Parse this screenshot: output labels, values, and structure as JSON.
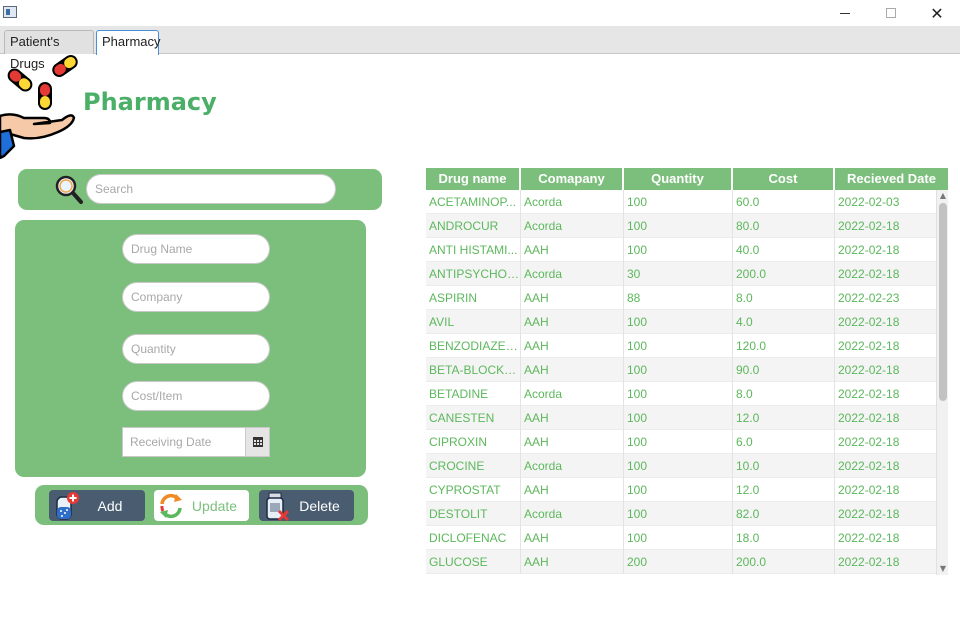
{
  "window": {
    "close_glyph": "✕"
  },
  "tabs": [
    {
      "label": "Patient's Drugs"
    },
    {
      "label": "Pharmacy"
    }
  ],
  "header": {
    "title": "Pharmacy"
  },
  "search": {
    "placeholder": "Search"
  },
  "form": {
    "drug_name_placeholder": "Drug Name",
    "company_placeholder": "Company",
    "quantity_placeholder": "Quantity",
    "cost_placeholder": "Cost/Item",
    "date_placeholder": "Receiving Date"
  },
  "actions": {
    "add_label": "Add",
    "update_label": "Update",
    "delete_label": "Delete"
  },
  "table": {
    "columns": [
      "Drug name",
      "Comapany",
      "Quantity",
      "Cost",
      "Recieved Date"
    ],
    "rows": [
      [
        "ACETAMINOP...",
        "Acorda",
        "100",
        "60.0",
        "2022-02-03"
      ],
      [
        "ANDROCUR",
        "Acorda",
        "100",
        "80.0",
        "2022-02-18"
      ],
      [
        "ANTI HISTAMI...",
        "AAH",
        "100",
        "40.0",
        "2022-02-18"
      ],
      [
        "ANTIPSYCHOTIC",
        "Acorda",
        "30",
        "200.0",
        "2022-02-18"
      ],
      [
        "ASPIRIN",
        "AAH",
        "88",
        "8.0",
        "2022-02-23"
      ],
      [
        "AVIL",
        "AAH",
        "100",
        "4.0",
        "2022-02-18"
      ],
      [
        "BENZODIAZEP...",
        "AAH",
        "100",
        "120.0",
        "2022-02-18"
      ],
      [
        "BETA-BLOCKER",
        "AAH",
        "100",
        "90.0",
        "2022-02-18"
      ],
      [
        "BETADINE",
        "Acorda",
        "100",
        "8.0",
        "2022-02-18"
      ],
      [
        "CANESTEN",
        "AAH",
        "100",
        "12.0",
        "2022-02-18"
      ],
      [
        "CIPROXIN",
        "AAH",
        "100",
        "6.0",
        "2022-02-18"
      ],
      [
        "CROCINE",
        "Acorda",
        "100",
        "10.0",
        "2022-02-18"
      ],
      [
        "CYPROSTAT",
        "AAH",
        "100",
        "12.0",
        "2022-02-18"
      ],
      [
        "DESTOLIT",
        "Acorda",
        "100",
        "82.0",
        "2022-02-18"
      ],
      [
        "DICLOFENAC",
        "AAH",
        "100",
        "18.0",
        "2022-02-18"
      ],
      [
        "GLUCOSE",
        "AAH",
        "200",
        "200.0",
        "2022-02-18"
      ]
    ]
  },
  "colors": {
    "accent_green": "#7cbf7c",
    "title_green": "#4caf68",
    "cell_text_green": "#5cb85c",
    "button_dark": "#4a5c70"
  },
  "icons": {
    "logo": "hand-with-pills-icon",
    "search": "magnifier-icon",
    "calendar": "calendar-icon",
    "add": "pill-bottle-plus-icon",
    "update": "refresh-arrows-icon",
    "delete": "pill-bottle-x-icon"
  }
}
